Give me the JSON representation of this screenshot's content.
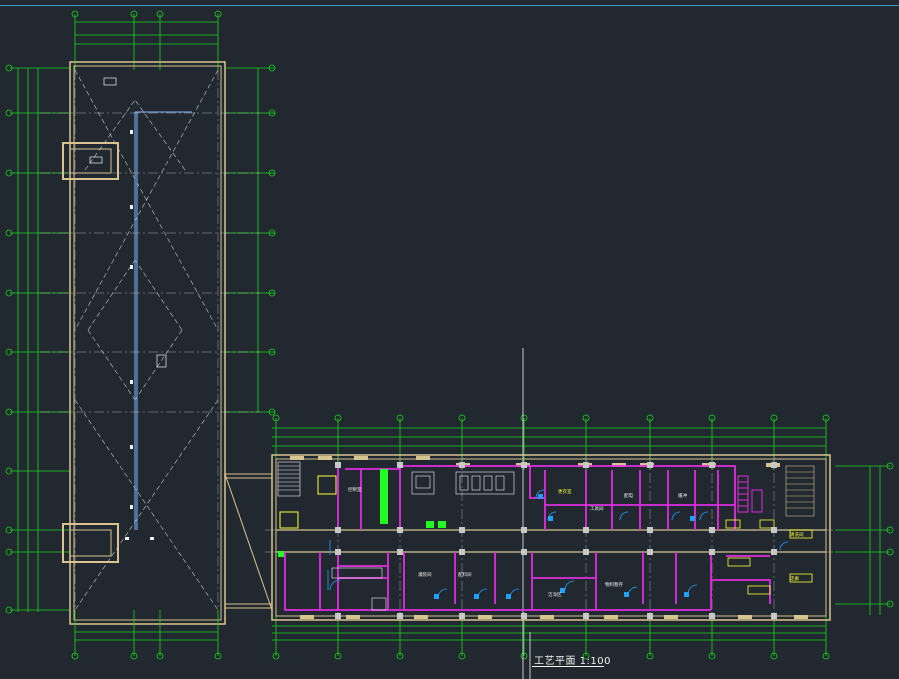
{
  "drawing": {
    "title": "工艺平面 1:100"
  },
  "colors": {
    "background": "#212830",
    "dimension": "#19d619",
    "wall": "#d8c48f",
    "partition": "#e02de0",
    "grid_axis": "#c8c8c8",
    "service": "#20a0ff",
    "accent": "#ffff33",
    "bright_green": "#22ff22"
  },
  "vertical_axes_left_block": [
    "1",
    "2",
    "3",
    "4"
  ],
  "horizontal_axes_left_block": [
    "A",
    "B",
    "C",
    "D",
    "E",
    "F",
    "G",
    "H",
    "J",
    "K",
    "L"
  ],
  "vertical_axes_right_block": [
    "1",
    "2",
    "3",
    "4",
    "5",
    "6",
    "7",
    "8",
    "9",
    "10",
    "11"
  ],
  "room_labels": [
    "控制室",
    "更衣室",
    "工具间",
    "配电",
    "缓冲",
    "洁净区",
    "灌装间",
    "配料间",
    "物料暂存",
    "清洗间",
    "走廊"
  ]
}
